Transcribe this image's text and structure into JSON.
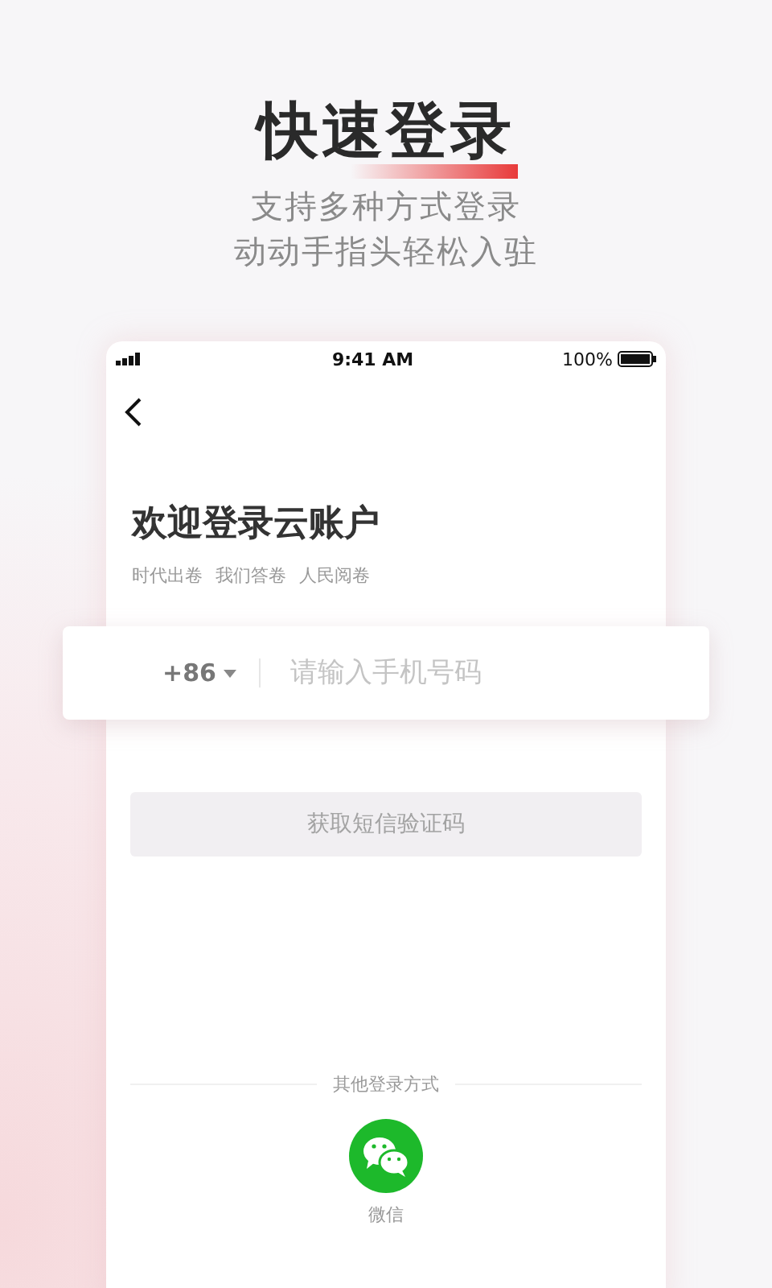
{
  "header": {
    "title": "快速登录",
    "subtitle_lines": [
      "支持多种方式登录",
      "动动手指头轻松入驻"
    ]
  },
  "phone_screen": {
    "status_bar": {
      "time": "9:41 AM",
      "battery": "100%"
    },
    "heading": "欢迎登录云账户",
    "taglines": [
      "时代出卷",
      "我们答卷",
      "人民阅卷"
    ],
    "phone_field": {
      "country_code": "+86",
      "placeholder": "请输入手机号码"
    },
    "sms_button": {
      "label": "获取短信验证码",
      "disabled": true
    },
    "other_login": {
      "label": "其他登录方式",
      "options": [
        {
          "kind": "wechat",
          "label": "微信"
        }
      ]
    }
  }
}
